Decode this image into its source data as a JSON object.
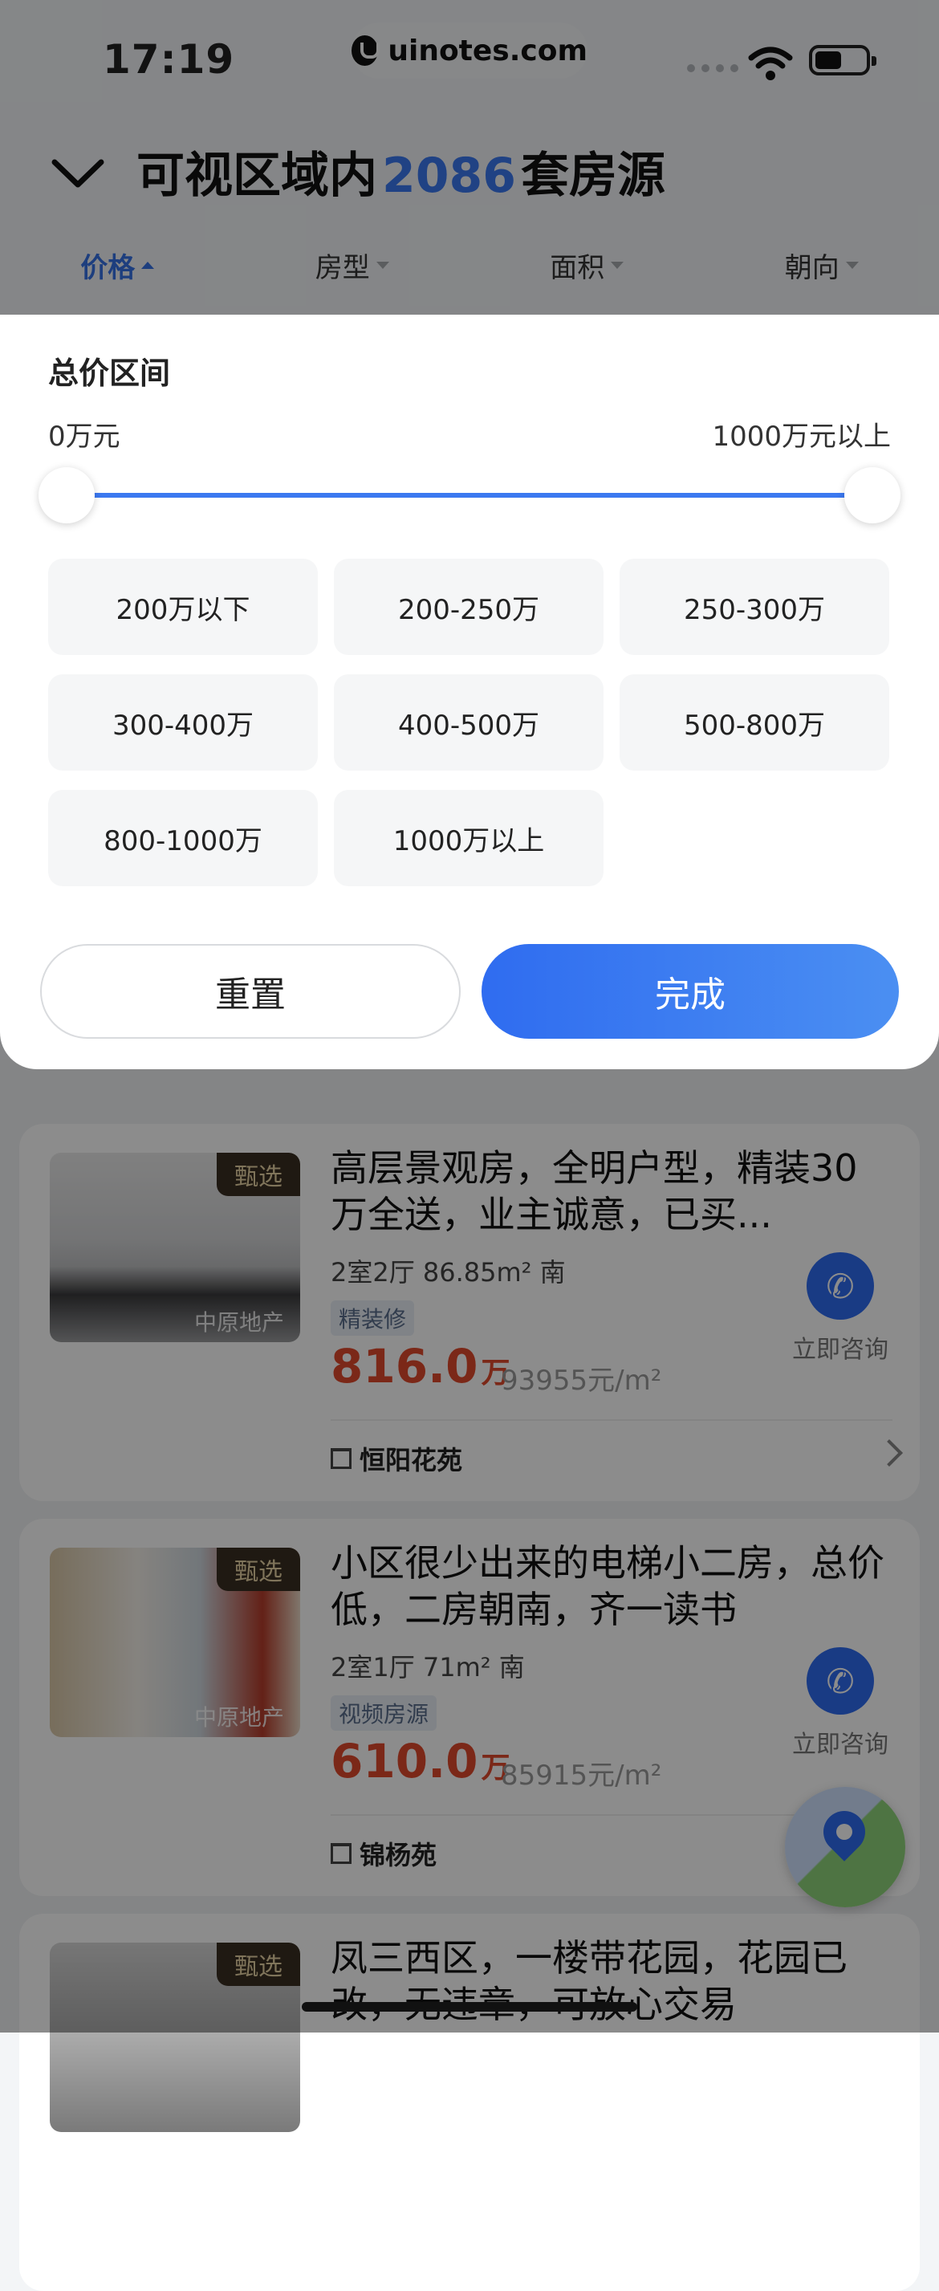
{
  "status": {
    "time": "17:19",
    "url": "uinotes.com"
  },
  "header": {
    "title_prefix": "可视区域内",
    "count": "2086",
    "title_suffix": "套房源"
  },
  "tabs": [
    {
      "label": "价格",
      "active": true
    },
    {
      "label": "房型",
      "active": false
    },
    {
      "label": "面积",
      "active": false
    },
    {
      "label": "朝向",
      "active": false
    }
  ],
  "filter": {
    "section_title": "总价区间",
    "range_min": "0万元",
    "range_max": "1000万元以上",
    "chips": [
      "200万以下",
      "200-250万",
      "250-300万",
      "300-400万",
      "400-500万",
      "500-800万",
      "800-1000万",
      "1000万以上"
    ],
    "reset_label": "重置",
    "done_label": "完成"
  },
  "listings": [
    {
      "badge": "甄选",
      "watermark": "中原地产",
      "title": "高层景观房，全明户型，精装30万全送，业主诚意，已买...",
      "meta": "2室2厅  86.85m²  南",
      "tag": "精装修",
      "price": "816.0",
      "price_unit": "万",
      "unit_price": "93955元/m²",
      "community": "恒阳花苑",
      "consult_label": "立即咨询"
    },
    {
      "badge": "甄选",
      "watermark": "中原地产",
      "title": "小区很少出来的电梯小二房，总价低，二房朝南，齐一读书",
      "meta": "2室1厅  71m²  南",
      "tag": "视频房源",
      "price": "610.0",
      "price_unit": "万",
      "unit_price": "85915元/m²",
      "community": "锦杨苑",
      "consult_label": "立即咨询"
    },
    {
      "badge": "甄选",
      "title": "凤三西区，一楼带花园，花园已改，无违章，可放心交易"
    }
  ],
  "colors": {
    "accent": "#3b78f0",
    "price": "#e14a2c"
  }
}
